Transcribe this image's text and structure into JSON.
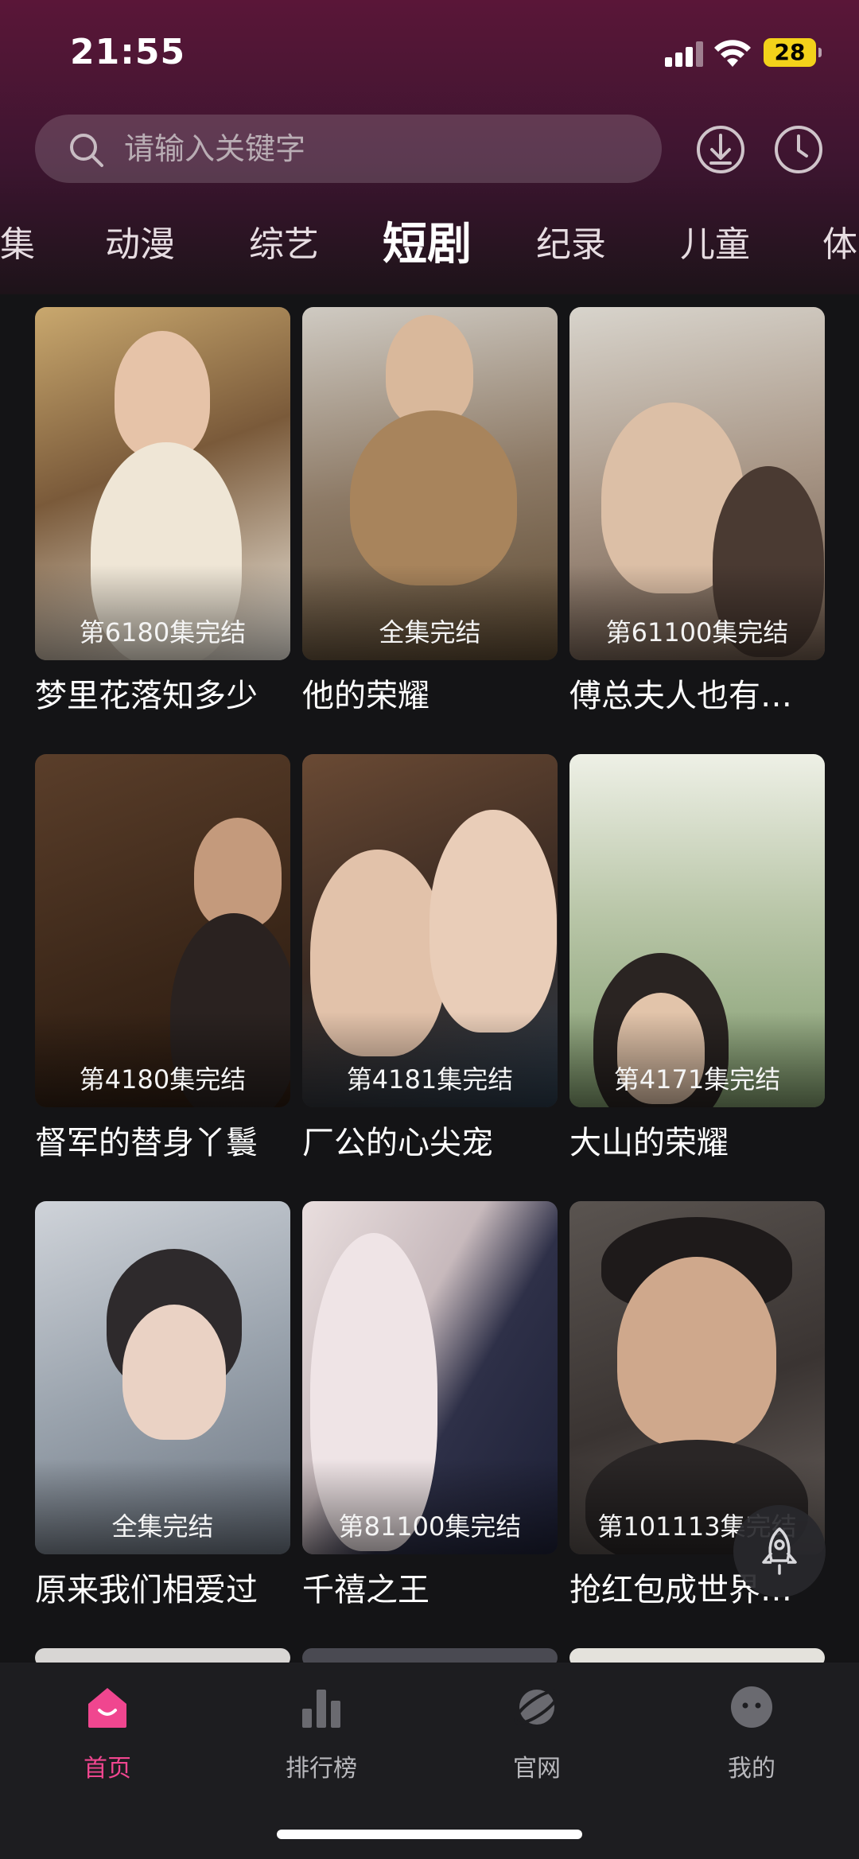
{
  "status_bar": {
    "time": "21:55",
    "battery": "28"
  },
  "search": {
    "placeholder": "请输入关键字"
  },
  "tabs": [
    {
      "label": "集"
    },
    {
      "label": "动漫"
    },
    {
      "label": "综艺"
    },
    {
      "label": "短剧",
      "active": true
    },
    {
      "label": "纪录"
    },
    {
      "label": "儿童"
    },
    {
      "label": "体"
    }
  ],
  "cards": [
    {
      "title": "梦里花落知多少",
      "episodes": "第6180集完结"
    },
    {
      "title": "他的荣耀",
      "episodes": "全集完结"
    },
    {
      "title": "傅总夫人也有…",
      "episodes": "第61100集完结"
    },
    {
      "title": "督军的替身丫鬟",
      "episodes": "第4180集完结"
    },
    {
      "title": "厂公的心尖宠",
      "episodes": "第4181集完结"
    },
    {
      "title": "大山的荣耀",
      "episodes": "第4171集完结"
    },
    {
      "title": "原来我们相爱过",
      "episodes": "全集完结"
    },
    {
      "title": "千禧之王",
      "episodes": "第81100集完结"
    },
    {
      "title": "抢红包成世界…",
      "episodes": "第101113集完结"
    }
  ],
  "bottom_nav": [
    {
      "label": "首页",
      "icon": "home-icon",
      "active": true
    },
    {
      "label": "排行榜",
      "icon": "ranking-icon"
    },
    {
      "label": "官网",
      "icon": "planet-icon"
    },
    {
      "label": "我的",
      "icon": "profile-icon"
    }
  ],
  "colors": {
    "accent": "#f0468f",
    "header_top": "#5a1638",
    "background": "#141416"
  }
}
